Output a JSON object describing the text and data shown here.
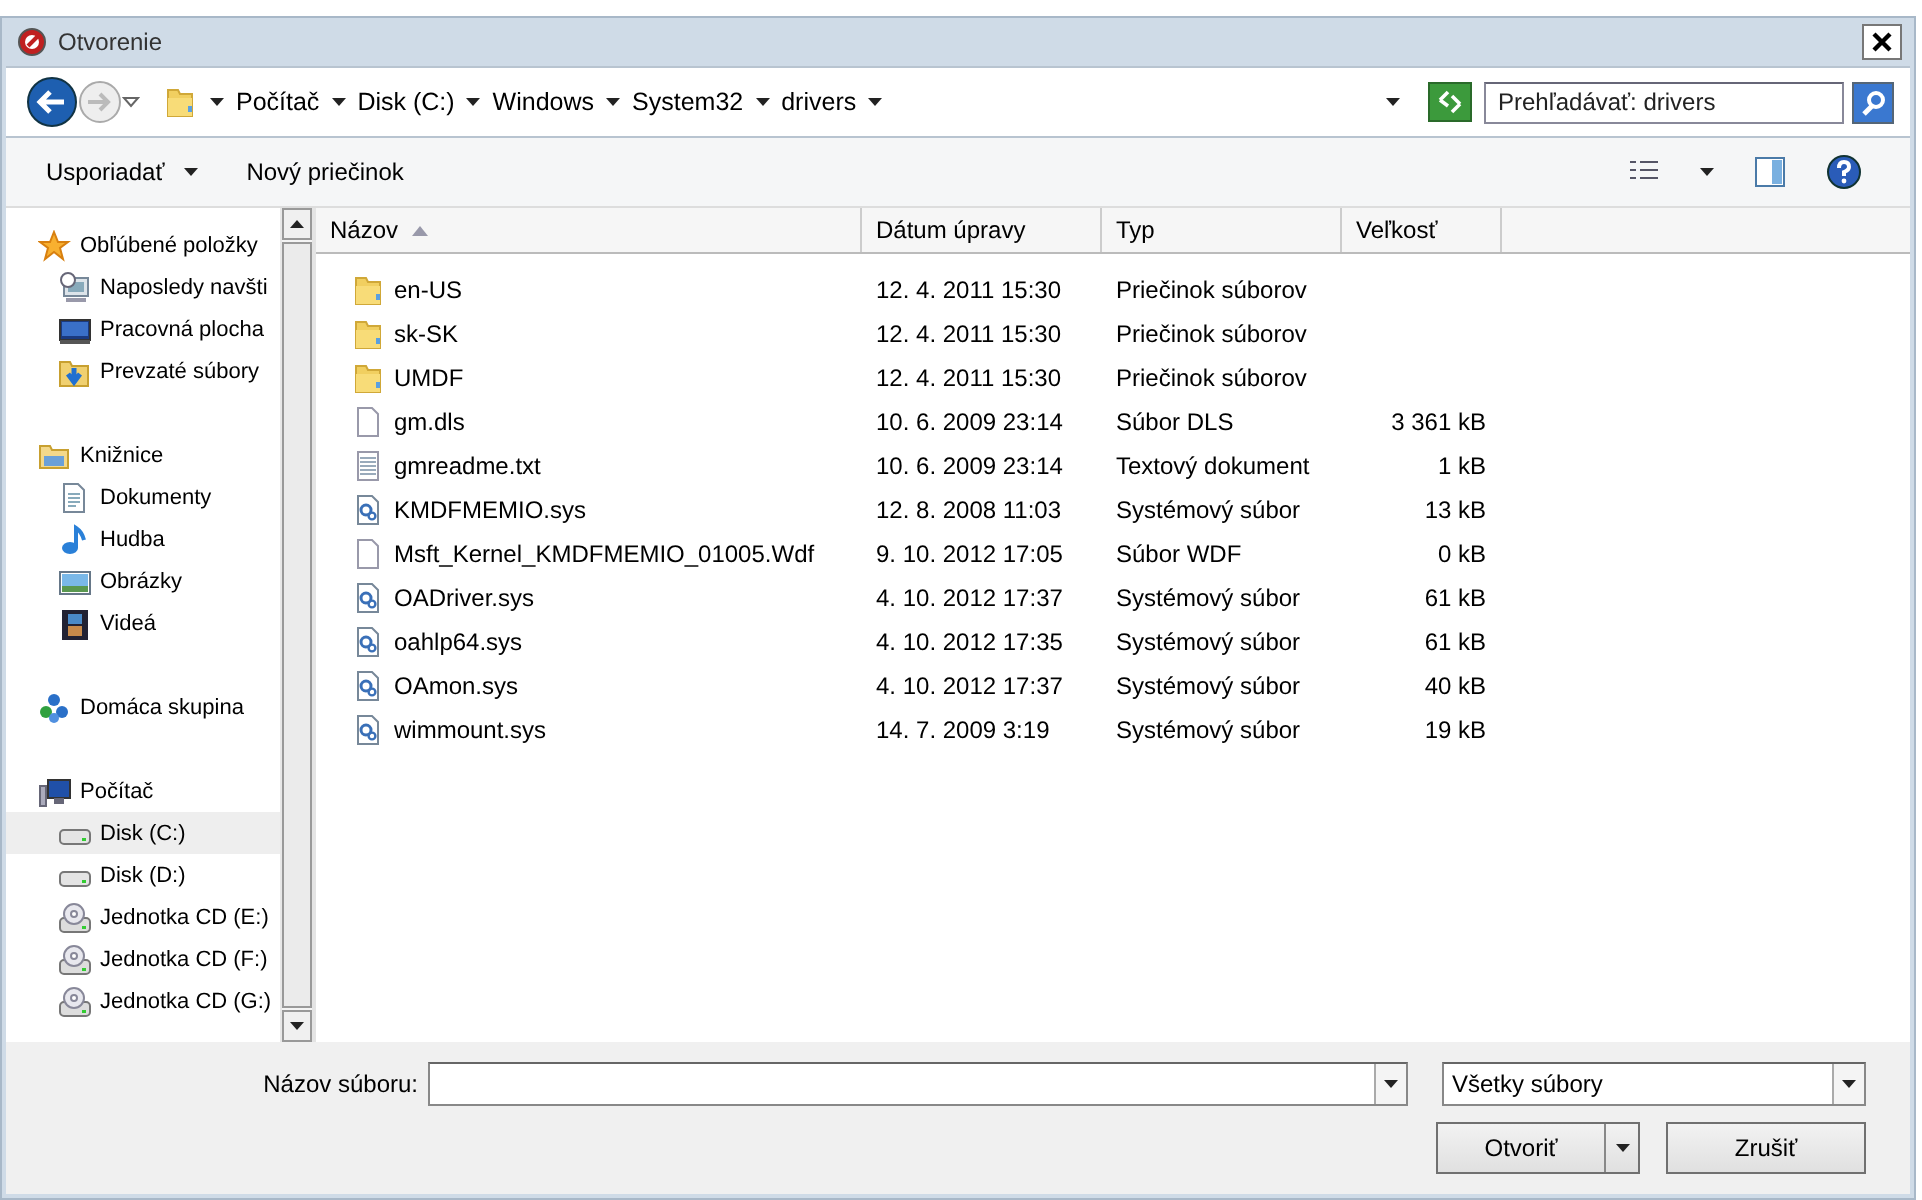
{
  "window": {
    "title": "Otvorenie"
  },
  "address": {
    "crumbs": [
      "Počítač",
      "Disk (C:)",
      "Windows",
      "System32",
      "drivers"
    ],
    "search_placeholder": "Prehľadávať: drivers"
  },
  "toolbar": {
    "organize": "Usporiadať",
    "new_folder": "Nový priečinok"
  },
  "nav": [
    {
      "label": "Obľúbené položky",
      "kind": "star",
      "selected": false,
      "children": [
        {
          "label": "Naposledy navšti",
          "kind": "recent",
          "selected": false
        },
        {
          "label": "Pracovná plocha",
          "kind": "desktop",
          "selected": false
        },
        {
          "label": "Prevzaté súbory",
          "kind": "download",
          "selected": false
        }
      ]
    },
    {
      "label": "Knižnice",
      "kind": "library",
      "selected": false,
      "children": [
        {
          "label": "Dokumenty",
          "kind": "document",
          "selected": false
        },
        {
          "label": "Hudba",
          "kind": "music",
          "selected": false
        },
        {
          "label": "Obrázky",
          "kind": "picture",
          "selected": false
        },
        {
          "label": "Videá",
          "kind": "video",
          "selected": false
        }
      ]
    },
    {
      "label": "Domáca skupina",
      "kind": "homegroup",
      "selected": false
    },
    {
      "label": "Počítač",
      "kind": "computer",
      "selected": false,
      "children": [
        {
          "label": "Disk (C:)",
          "kind": "disk",
          "selected": true
        },
        {
          "label": "Disk (D:)",
          "kind": "disk",
          "selected": false
        },
        {
          "label": "Jednotka CD (E:)",
          "kind": "cd",
          "selected": false
        },
        {
          "label": "Jednotka CD (F:)",
          "kind": "cd",
          "selected": false
        },
        {
          "label": "Jednotka CD (G:)",
          "kind": "cd",
          "selected": false
        }
      ]
    }
  ],
  "table": {
    "columns": [
      {
        "label": "Názov",
        "sorted": true
      },
      {
        "label": "Dátum úpravy",
        "sorted": false
      },
      {
        "label": "Typ",
        "sorted": false
      },
      {
        "label": "Veľkosť",
        "sorted": false
      }
    ],
    "rows": [
      {
        "kind": "folder",
        "name": "en-US",
        "date": "12. 4. 2011 15:30",
        "type": "Priečinok súborov"
      },
      {
        "kind": "folder",
        "name": "sk-SK",
        "date": "12. 4. 2011 15:30",
        "type": "Priečinok súborov"
      },
      {
        "kind": "folder",
        "name": "UMDF",
        "date": "12. 4. 2011 15:30",
        "type": "Priečinok súborov"
      },
      {
        "kind": "file",
        "name": "gm.dls",
        "date": "10. 6. 2009 23:14",
        "type": "Súbor DLS",
        "size": "3 361 kB"
      },
      {
        "kind": "text",
        "name": "gmreadme.txt",
        "date": "10. 6. 2009 23:14",
        "type": "Textový dokument",
        "size": "1 kB"
      },
      {
        "kind": "system",
        "name": "KMDFMEMIO.sys",
        "date": "12. 8. 2008 11:03",
        "type": "Systémový súbor",
        "size": "13 kB"
      },
      {
        "kind": "file",
        "name": "Msft_Kernel_KMDFMEMIO_01005.Wdf",
        "date": "9. 10. 2012 17:05",
        "type": "Súbor WDF",
        "size": "0 kB"
      },
      {
        "kind": "system",
        "name": "OADriver.sys",
        "date": "4. 10. 2012 17:37",
        "type": "Systémový súbor",
        "size": "61 kB"
      },
      {
        "kind": "system",
        "name": "oahlp64.sys",
        "date": "4. 10. 2012 17:35",
        "type": "Systémový súbor",
        "size": "61 kB"
      },
      {
        "kind": "system",
        "name": "OAmon.sys",
        "date": "4. 10. 2012 17:37",
        "type": "Systémový súbor",
        "size": "40 kB"
      },
      {
        "kind": "system",
        "name": "wimmount.sys",
        "date": "14. 7. 2009 3:19",
        "type": "Systémový súbor",
        "size": "19 kB"
      }
    ]
  },
  "footer": {
    "filename_label": "Názov súboru:",
    "filter": "Všetky súbory",
    "open": "Otvoriť",
    "cancel": "Zrušiť"
  }
}
